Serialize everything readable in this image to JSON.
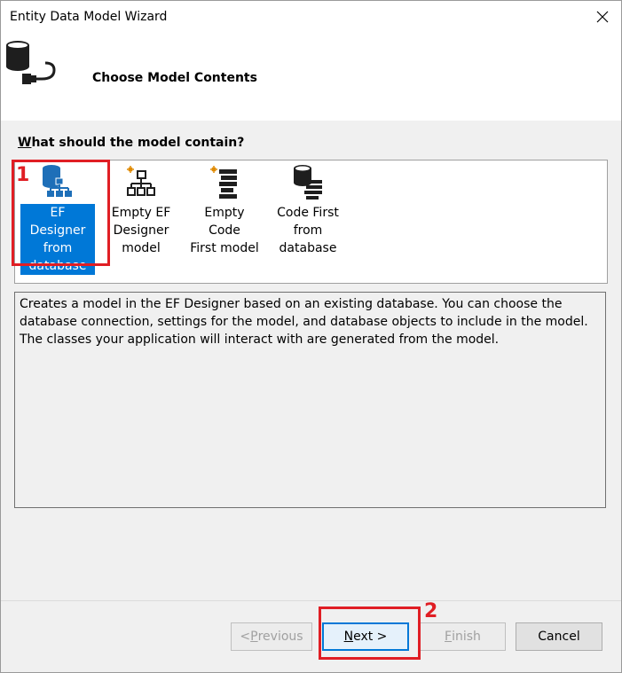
{
  "window": {
    "title": "Entity Data Model Wizard"
  },
  "header": {
    "title": "Choose Model Contents"
  },
  "question": {
    "prefix": "W",
    "rest": "hat should the model contain?"
  },
  "model_options": [
    {
      "label": "EF Designer\nfrom\ndatabase",
      "icon": "ef-designer-database-icon",
      "selected": true
    },
    {
      "label": "Empty EF\nDesigner\nmodel",
      "icon": "empty-ef-designer-icon",
      "selected": false
    },
    {
      "label": "Empty Code\nFirst model",
      "icon": "empty-code-first-icon",
      "selected": false
    },
    {
      "label": "Code First\nfrom\ndatabase",
      "icon": "code-first-database-icon",
      "selected": false
    }
  ],
  "description": "Creates a model in the EF Designer based on an existing database. You can choose the database connection, settings for the model, and database objects to include in the model. The classes your application will interact with are generated from the model.",
  "buttons": {
    "previous": {
      "prefix": "< ",
      "mnemonic": "P",
      "rest": "revious",
      "enabled": false
    },
    "next": {
      "mnemonic": "N",
      "rest": "ext >",
      "enabled": true
    },
    "finish": {
      "mnemonic": "F",
      "rest": "inish",
      "enabled": false
    },
    "cancel": {
      "label": "Cancel",
      "enabled": true
    }
  },
  "annotations": {
    "marker1": "1",
    "marker2": "2"
  },
  "colors": {
    "selection": "#0078d7",
    "annotation": "#e01e24",
    "icon_blue": "#1e6fb8"
  }
}
